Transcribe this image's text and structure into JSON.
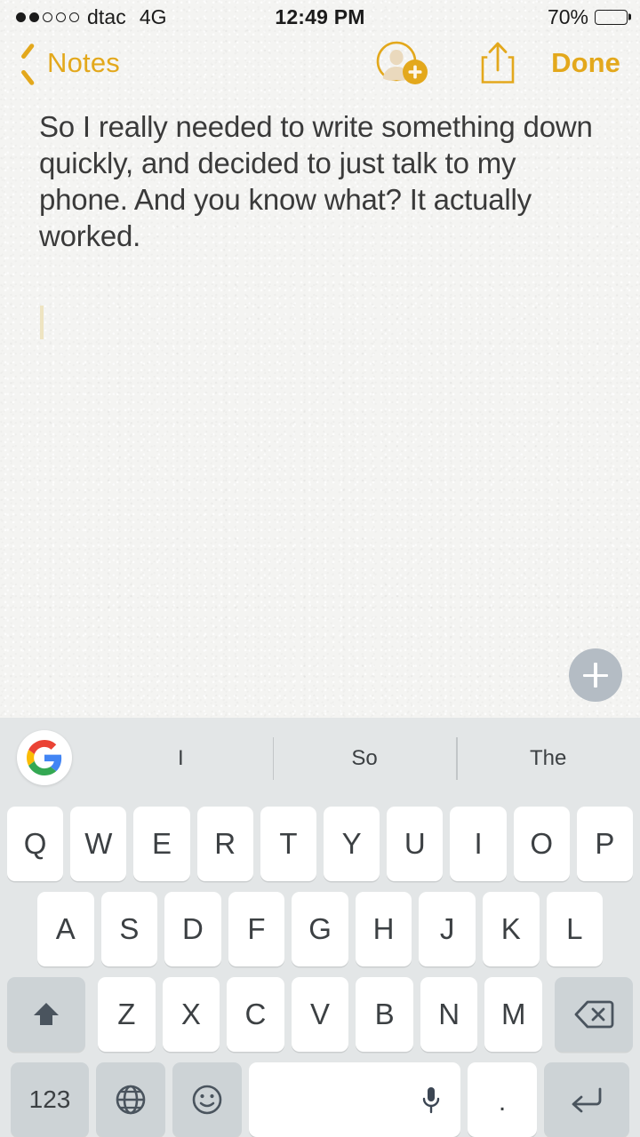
{
  "status_bar": {
    "signal_dots_total": 5,
    "signal_dots_filled": 2,
    "carrier": "dtac",
    "network": "4G",
    "time": "12:49 PM",
    "battery_percent_label": "70%",
    "battery_level": 70
  },
  "nav_bar": {
    "back_label": "Notes",
    "back_icon": "chevron-left-icon",
    "add_person_icon": "add-collaborator-icon",
    "share_icon": "share-icon",
    "done_label": "Done",
    "accent_color": "#e3a81c"
  },
  "note": {
    "body": "So I really needed to write something down quickly, and decided to just talk to my phone. And you know what? It actually worked.",
    "text_color": "#3a3a3a",
    "paper_color": "#f4f4f2"
  },
  "fab": {
    "icon": "plus-icon",
    "color": "#b4bcc4"
  },
  "keyboard": {
    "background": "#e3e6e7",
    "key_color": "#ffffff",
    "modifier_key_color": "#cdd3d6",
    "key_text_color": "#3c4043",
    "logo_icon": "google-g-icon",
    "suggestions": [
      "I",
      "So",
      "The"
    ],
    "row1": [
      "Q",
      "W",
      "E",
      "R",
      "T",
      "Y",
      "U",
      "I",
      "O",
      "P"
    ],
    "row2": [
      "A",
      "S",
      "D",
      "F",
      "G",
      "H",
      "J",
      "K",
      "L"
    ],
    "row3": {
      "shift_icon": "shift-icon",
      "letters": [
        "Z",
        "X",
        "C",
        "V",
        "B",
        "N",
        "M"
      ],
      "backspace_icon": "backspace-icon"
    },
    "row4": {
      "numbers_label": "123",
      "globe_icon": "globe-icon",
      "emoji_icon": "emoji-icon",
      "space_label": "",
      "mic_icon": "microphone-icon",
      "period_label": ".",
      "enter_icon": "enter-icon"
    }
  }
}
